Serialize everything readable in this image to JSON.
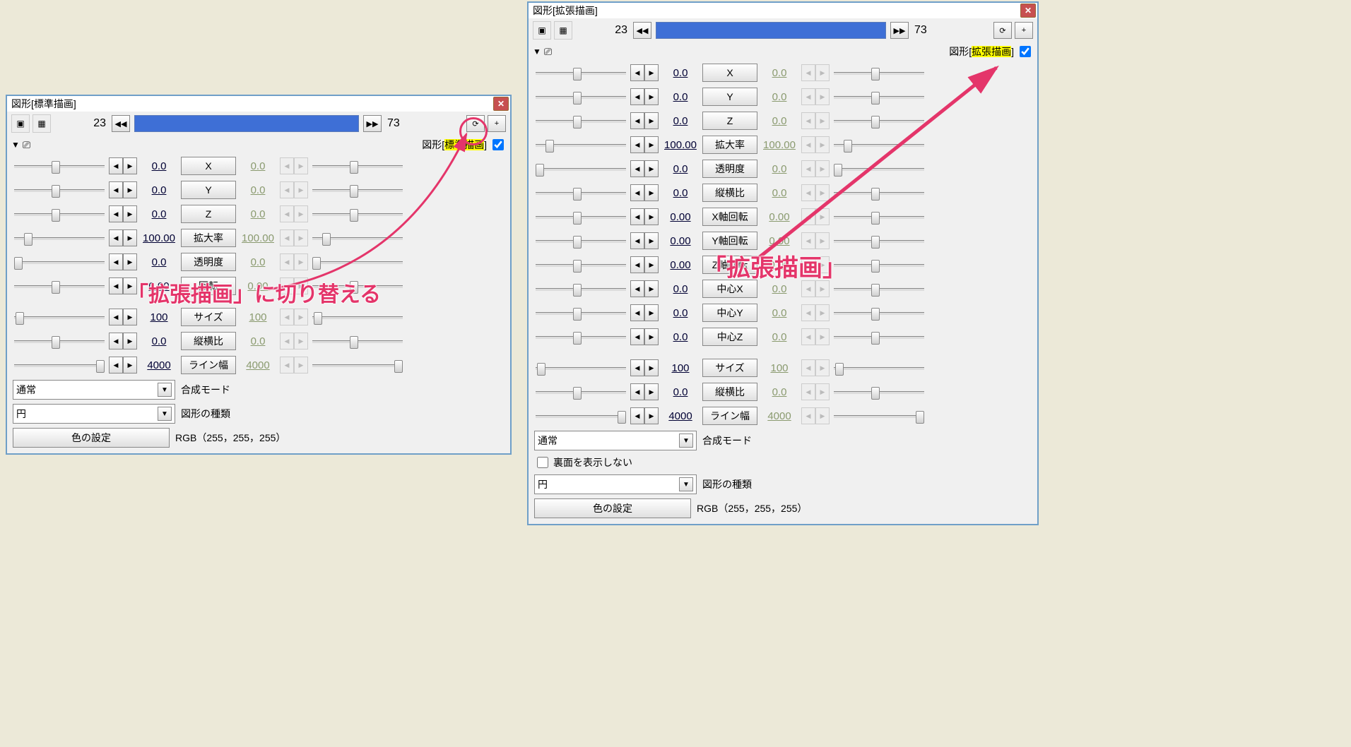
{
  "windows": {
    "standard": {
      "title": "図形[標準描画]",
      "frame_start": "23",
      "frame_end": "73",
      "type_prefix": "図形[",
      "type_hl": "標準描画",
      "type_suffix": "]",
      "rotation_visible": true,
      "params": [
        {
          "label": "X",
          "lv": "0.0",
          "rv": "0.0",
          "lp": 46,
          "rp": 46
        },
        {
          "label": "Y",
          "lv": "0.0",
          "rv": "0.0",
          "lp": 46,
          "rp": 46
        },
        {
          "label": "Z",
          "lv": "0.0",
          "rv": "0.0",
          "lp": 46,
          "rp": 46
        },
        {
          "label": "拡大率",
          "lv": "100.00",
          "rv": "100.00",
          "lp": 12,
          "rp": 12
        },
        {
          "label": "透明度",
          "lv": "0.0",
          "rv": "0.0",
          "lp": 0,
          "rp": 0
        },
        {
          "label": "回転",
          "lv": "0.00",
          "rv": "0.00",
          "lp": 46,
          "rp": 46
        }
      ],
      "params2": [
        {
          "label": "サイズ",
          "lv": "100",
          "rv": "100",
          "lp": 2,
          "rp": 2
        },
        {
          "label": "縦横比",
          "lv": "0.0",
          "rv": "0.0",
          "lp": 46,
          "rp": 46
        },
        {
          "label": "ライン幅",
          "lv": "4000",
          "rv": "4000",
          "lp": 100,
          "rp": 100
        }
      ],
      "bottom": {
        "blend_label": "合成モード",
        "blend_value": "通常",
        "shape_label": "図形の種類",
        "shape_value": "円",
        "color_btn": "色の設定",
        "rgb": "RGB（255，255，255）"
      }
    },
    "extended": {
      "title": "図形[拡張描画]",
      "frame_start": "23",
      "frame_end": "73",
      "type_prefix": "図形[",
      "type_hl": "拡張描画",
      "type_suffix": "]",
      "params": [
        {
          "label": "X",
          "lv": "0.0",
          "rv": "0.0",
          "lp": 46,
          "rp": 46
        },
        {
          "label": "Y",
          "lv": "0.0",
          "rv": "0.0",
          "lp": 46,
          "rp": 46
        },
        {
          "label": "Z",
          "lv": "0.0",
          "rv": "0.0",
          "lp": 46,
          "rp": 46
        },
        {
          "label": "拡大率",
          "lv": "100.00",
          "rv": "100.00",
          "lp": 12,
          "rp": 12
        },
        {
          "label": "透明度",
          "lv": "0.0",
          "rv": "0.0",
          "lp": 0,
          "rp": 0
        },
        {
          "label": "縦横比",
          "lv": "0.0",
          "rv": "0.0",
          "lp": 46,
          "rp": 46
        },
        {
          "label": "X軸回転",
          "lv": "0.00",
          "rv": "0.00",
          "lp": 46,
          "rp": 46
        },
        {
          "label": "Y軸回転",
          "lv": "0.00",
          "rv": "0.00",
          "lp": 46,
          "rp": 46
        },
        {
          "label": "Z軸回転",
          "lv": "0.00",
          "rv": "0.00",
          "lp": 46,
          "rp": 46
        },
        {
          "label": "中心X",
          "lv": "0.0",
          "rv": "0.0",
          "lp": 46,
          "rp": 46
        },
        {
          "label": "中心Y",
          "lv": "0.0",
          "rv": "0.0",
          "lp": 46,
          "rp": 46
        },
        {
          "label": "中心Z",
          "lv": "0.0",
          "rv": "0.0",
          "lp": 46,
          "rp": 46
        }
      ],
      "params2": [
        {
          "label": "サイズ",
          "lv": "100",
          "rv": "100",
          "lp": 2,
          "rp": 2
        },
        {
          "label": "縦横比",
          "lv": "0.0",
          "rv": "0.0",
          "lp": 46,
          "rp": 46
        },
        {
          "label": "ライン幅",
          "lv": "4000",
          "rv": "4000",
          "lp": 100,
          "rp": 100
        }
      ],
      "bottom": {
        "blend_label": "合成モード",
        "blend_value": "通常",
        "backface_label": "裏面を表示しない",
        "shape_label": "図形の種類",
        "shape_value": "円",
        "color_btn": "色の設定",
        "rgb": "RGB（255，255，255）"
      }
    }
  },
  "annotations": {
    "text_left": "「拡張描画」に切り替える",
    "text_right": "「拡張描画」"
  }
}
